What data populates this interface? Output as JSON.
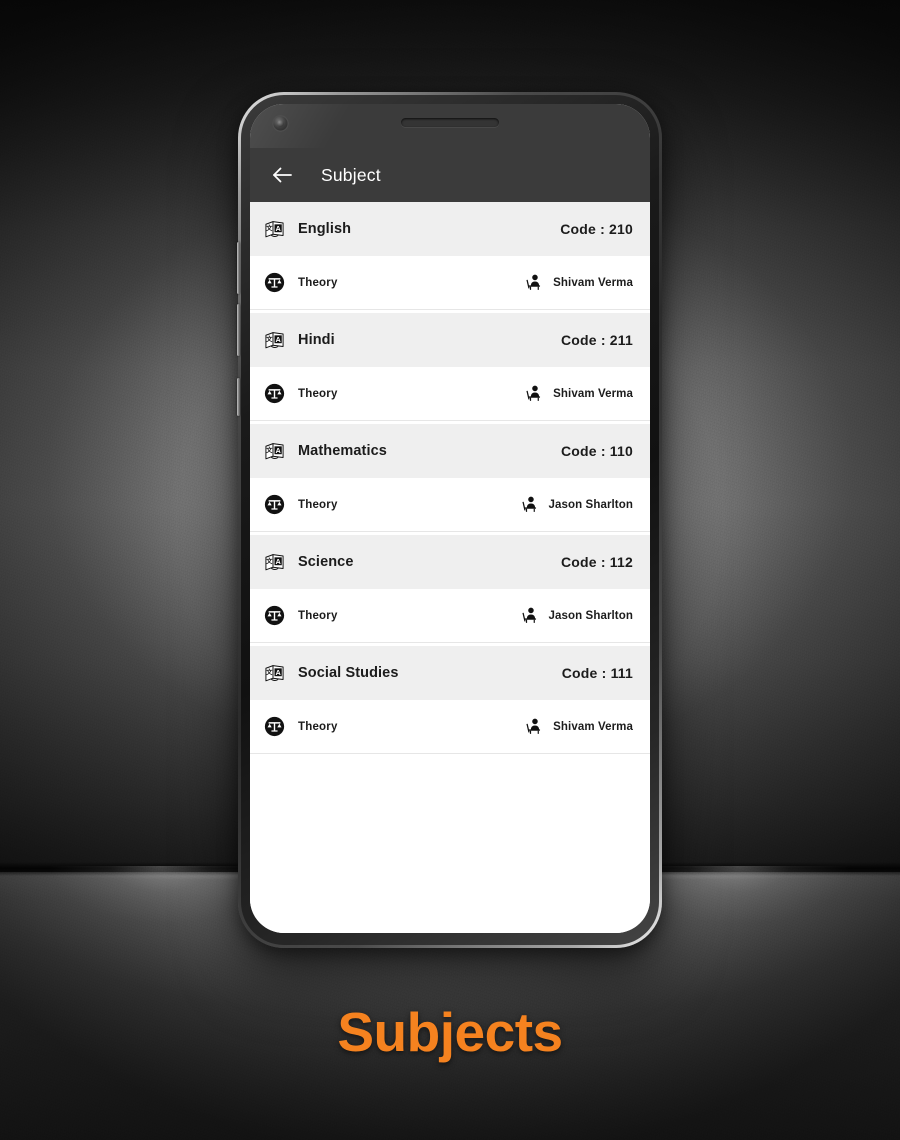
{
  "caption": "Subjects",
  "accent_color": "#F5821F",
  "phone": {
    "appbar": {
      "back_icon": "back-arrow-icon",
      "title": "Subject",
      "background_color": "#3b3b3b",
      "title_color": "#ffffff"
    },
    "camera_icon": "front-camera-icon",
    "earpiece_icon": "earpiece-speaker-icon"
  },
  "list": {
    "subject_row_bg": "#efefef",
    "theory_row_bg": "#ffffff",
    "subject_icon": "translate-book-icon",
    "theory_icon": "balance-scales-circle-icon",
    "teacher_icon": "teacher-at-desk-icon",
    "groups": [
      {
        "subject": "English",
        "code": "Code : 210",
        "type_label": "Theory",
        "teacher": "Shivam Verma"
      },
      {
        "subject": "Hindi",
        "code": "Code : 211",
        "type_label": "Theory",
        "teacher": "Shivam Verma"
      },
      {
        "subject": "Mathematics",
        "code": "Code : 110",
        "type_label": "Theory",
        "teacher": "Jason Sharlton"
      },
      {
        "subject": "Science",
        "code": "Code : 112",
        "type_label": "Theory",
        "teacher": "Jason Sharlton"
      },
      {
        "subject": "Social Studies",
        "code": "Code : 111",
        "type_label": "Theory",
        "teacher": "Shivam Verma"
      }
    ]
  }
}
